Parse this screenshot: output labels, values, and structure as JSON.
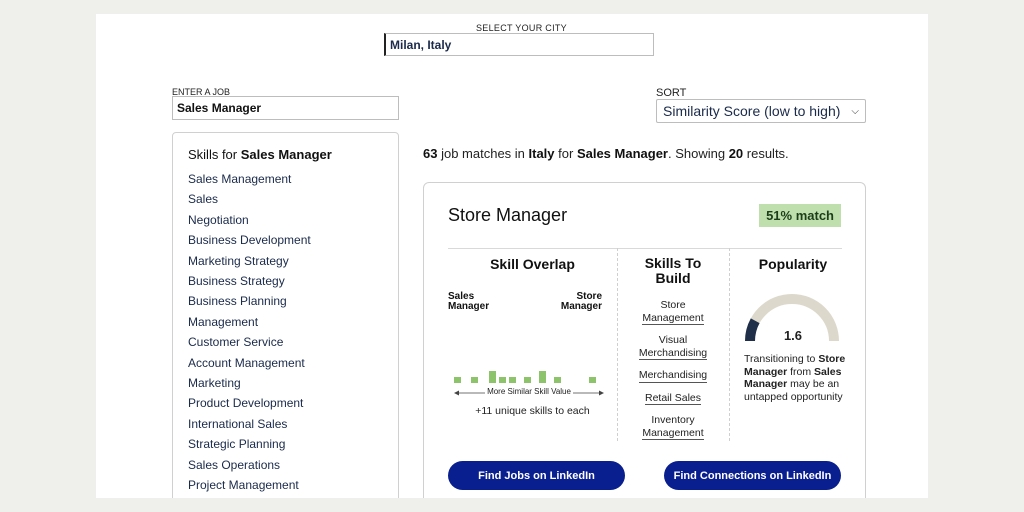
{
  "city": {
    "label": "SELECT YOUR CITY",
    "value": "Milan, Italy"
  },
  "job": {
    "label": "ENTER A JOB",
    "value": "Sales Manager"
  },
  "sort": {
    "label": "SORT",
    "value": "Similarity Score (low to high)",
    "icon": "chevron-down-icon"
  },
  "skills_panel": {
    "title_prefix": "Skills for",
    "title_job": "Sales Manager",
    "items": [
      "Sales Management",
      "Sales",
      "Negotiation",
      "Business Development",
      "Marketing Strategy",
      "Business Strategy",
      "Business Planning",
      "Management",
      "Customer Service",
      "Account Management",
      "Marketing",
      "Product Development",
      "International Sales",
      "Strategic Planning",
      "Sales Operations",
      "Project Management"
    ]
  },
  "summary": {
    "count": "63",
    "text1": " job matches in ",
    "country": "Italy",
    "text2": " for ",
    "job": "Sales Manager",
    "text3": ". Showing ",
    "shown": "20",
    "text4": " results."
  },
  "card": {
    "title": "Store Manager",
    "match": "51% match",
    "overlap": {
      "title": "Skill Overlap",
      "left_line1": "Sales",
      "left_line2": "Manager",
      "right_line1": "Store",
      "right_line2": "Manager",
      "arrow_label": "More Similar Skill Value",
      "unique": "+11 unique skills to each",
      "bar_color": "#8dc46b"
    },
    "build": {
      "title_line1": "Skills To",
      "title_line2": "Build",
      "items": [
        [
          "Store",
          "Management"
        ],
        [
          "Visual",
          "Merchandising"
        ],
        [
          "Merchandising"
        ],
        [
          "Retail Sales"
        ],
        [
          "Inventory",
          "Management"
        ]
      ]
    },
    "popularity": {
      "title": "Popularity",
      "value": "1.6",
      "fraction": 0.16,
      "text1": "Transitioning to ",
      "job_to": "Store Manager",
      "text2": " from ",
      "job_from": "Sales Manager",
      "text3": " may be an untapped opportunity",
      "fill_color": "#1f2f4a",
      "track_color": "#ddd8cc"
    },
    "buttons": {
      "jobs": "Find Jobs on LinkedIn",
      "connections": "Find Connections on LinkedIn",
      "color": "#0a1f8f"
    }
  }
}
